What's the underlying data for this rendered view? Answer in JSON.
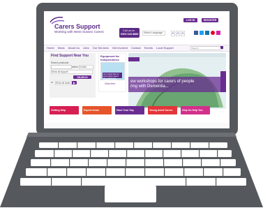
{
  "brand": {
    "title": "Carers Support",
    "subtitle": "Working with West Sussex Carers"
  },
  "header": {
    "call_label": "Call us on",
    "phone": "0300 028 8888",
    "login": "LOG IN",
    "register": "REGISTER",
    "select_language": "Select Language",
    "text_sizes": [
      "A",
      "A",
      "A"
    ]
  },
  "nav": {
    "items": [
      "Home",
      "News",
      "About Us",
      "Jobs",
      "Our Services",
      "Get involved",
      "Contact",
      "Events",
      "Local Support"
    ],
    "search_placeholder": "Search"
  },
  "find_support": {
    "title": "Find Support Near You",
    "postcode_label": "Search postcode",
    "within_label": "within",
    "miles_value": "5 miles",
    "type_value": "Show all support",
    "search_button": "SEARCH",
    "or_label": "or",
    "area_value": "Show all areas"
  },
  "equipment": {
    "title": "Equipment for Independence",
    "caption": "Our Handy Bar for information about the equipment available to you",
    "link": "Click here"
  },
  "hero": {
    "text": "ew workshops for carers of people\nring with Dementia..."
  },
  "tiles": [
    {
      "label": "Getting Help",
      "color": "#d61f52"
    },
    {
      "label": "Expert Areas",
      "color": "#e5542a"
    },
    {
      "label": "Have Your Say",
      "color": "#6a2c91"
    },
    {
      "label": "Young Adult Carers",
      "color": "#e3353a"
    },
    {
      "label": "Help Us Help You",
      "color": "#d32f8b"
    }
  ],
  "colors": {
    "brand_purple": "#5b2a86",
    "laptop_body": "#55585c",
    "key_fill": "#ffffff"
  }
}
